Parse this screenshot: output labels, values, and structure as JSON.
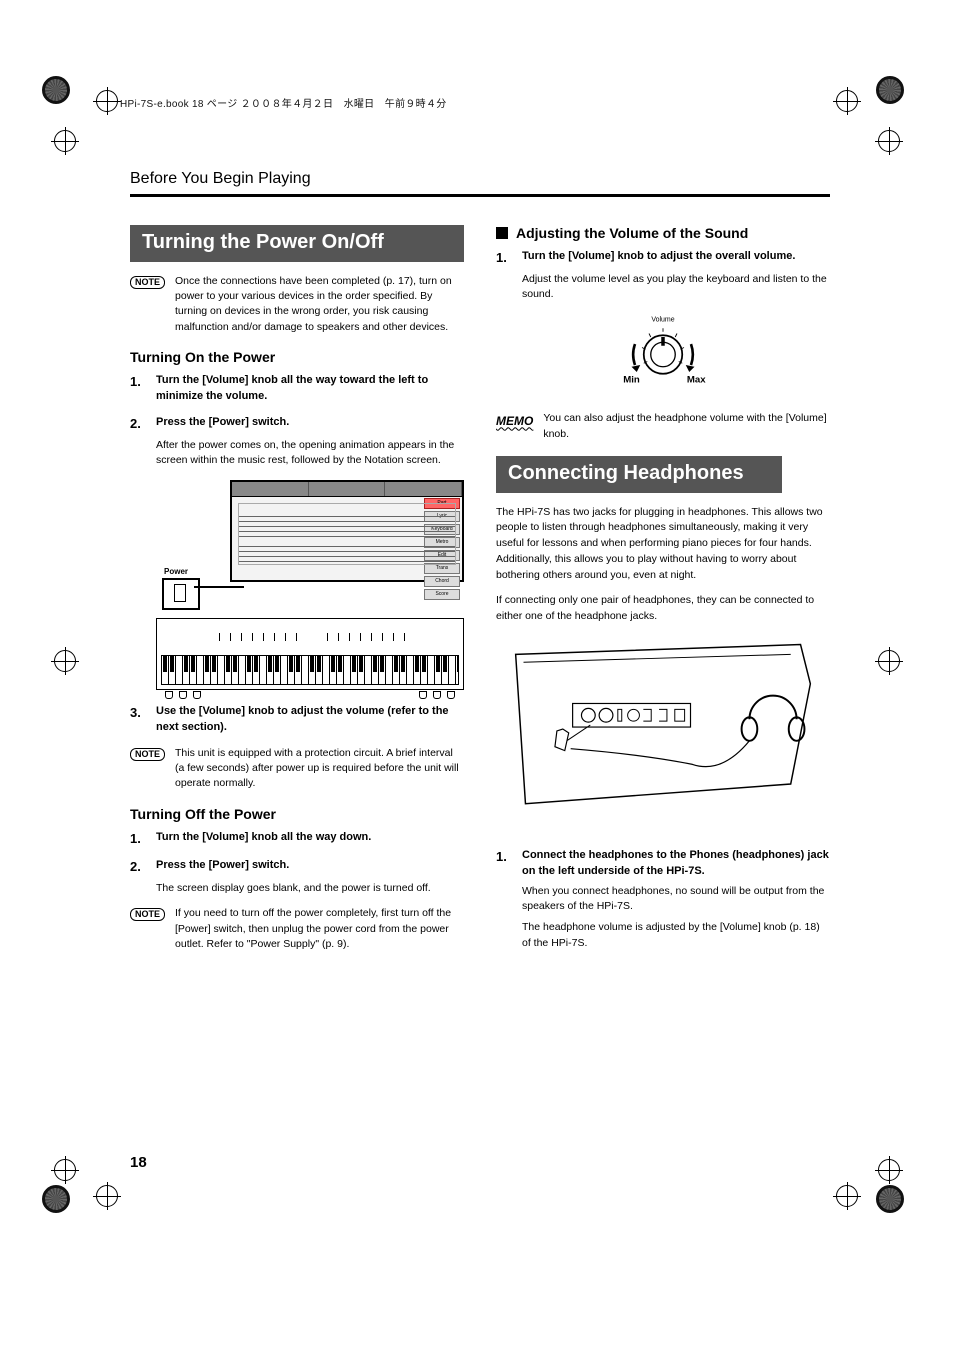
{
  "header": {
    "running_info": "HPi-7S-e.book  18 ページ  ２００８年４月２日　水曜日　午前９時４分",
    "section_title": "Before You Begin Playing"
  },
  "left": {
    "banner": "Turning the Power On/Off",
    "note_intro": "Once the connections have been completed (p. 17), turn on power to your various devices in the order specified. By turning on devices in the wrong order, you risk causing malfunction and/or damage to speakers and other devices.",
    "on": {
      "heading": "Turning On the Power",
      "steps": [
        {
          "head": "Turn the [Volume] knob all the way toward the left to minimize the volume."
        },
        {
          "head": "Press the [Power] switch.",
          "body": "After the power comes on, the opening animation appears in the screen within the music rest, followed by the Notation screen."
        },
        {
          "head": "Use the [Volume] knob to adjust the volume (refer to the next section)."
        }
      ],
      "figure": {
        "power_label": "Power",
        "screen_side_buttons": [
          "Part",
          "Lyric",
          "Keyboard",
          "Metro",
          "Edit",
          "Trans",
          "Chord",
          "Score"
        ]
      },
      "note_after": "This unit is equipped with a protection circuit. A brief interval (a few seconds) after power up is required before the unit will operate normally."
    },
    "off": {
      "heading": "Turning Off the Power",
      "steps": [
        {
          "head": "Turn the [Volume] knob all the way down."
        },
        {
          "head": "Press the [Power] switch.",
          "body": "The screen display goes blank, and the power is turned off."
        }
      ],
      "note_after": "If you need to turn off the power completely, first turn off the [Power] switch, then unplug the power cord from the power outlet. Refer to \"Power Supply\" (p. 9)."
    }
  },
  "right": {
    "vol": {
      "heading": "Adjusting the Volume of the Sound",
      "step_head": "Turn the [Volume] knob to adjust the overall volume.",
      "step_body": "Adjust the volume level as you play the keyboard and listen to the sound.",
      "knob": {
        "label": "Volume",
        "min": "Min",
        "max": "Max"
      },
      "memo": "You can also adjust the headphone volume with the [Volume] knob."
    },
    "hp": {
      "banner": "Connecting Headphones",
      "para1": "The HPi-7S has two jacks for plugging in headphones. This allows two people to listen through headphones simultaneously, making it very useful for lessons and when performing piano pieces for four hands. Additionally, this allows you to play without having to worry about bothering others around you, even at night.",
      "para2": "If connecting only one pair of headphones, they can be connected to either one of the headphone jacks.",
      "step_head": "Connect the headphones to the Phones (headphones) jack on the left underside of the HPi-7S.",
      "step_body1": "When you connect headphones, no sound will be output from the speakers of the HPi-7S.",
      "step_body2": "The headphone volume is adjusted by the [Volume] knob (p. 18) of the HPi-7S."
    }
  },
  "page_number": "18",
  "labels": {
    "note": "NOTE",
    "memo": "MEMO"
  }
}
